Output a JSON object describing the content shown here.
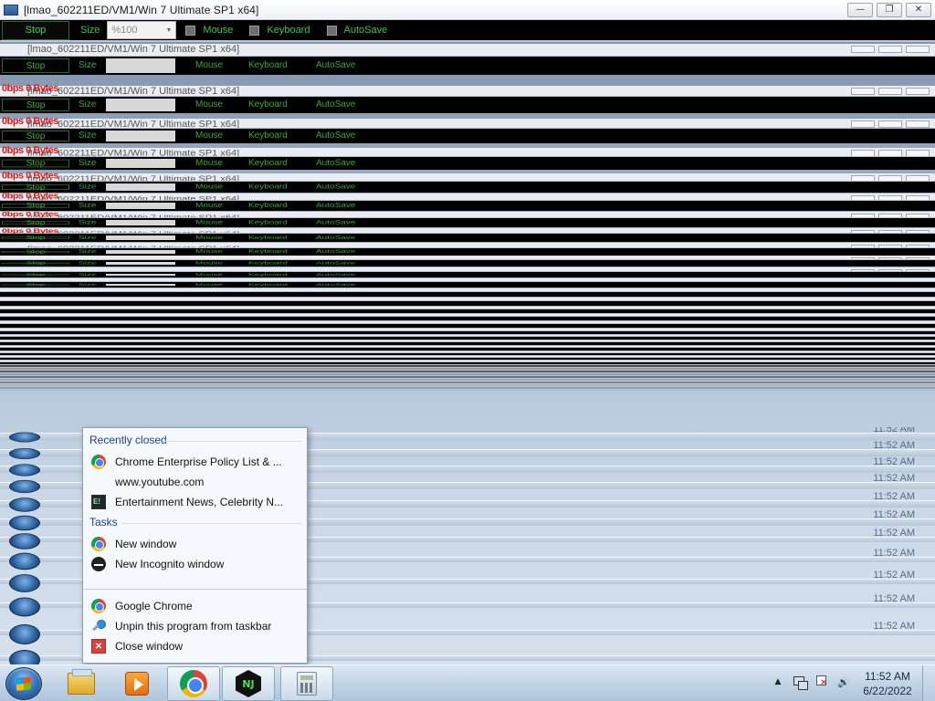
{
  "viewer": {
    "title": "[lmao_602211ED/VM1/Win 7 Ultimate SP1 x64]",
    "window_buttons": {
      "minimize": "—",
      "restore": "❐",
      "close": "✕"
    },
    "toolbar": {
      "stop_label": "Stop",
      "size_label": "Size",
      "size_value": "%100",
      "mouse_label": "Mouse",
      "keyboard_label": "Keyboard",
      "autosave_label": "AutoSave"
    }
  },
  "glitch_overlay_text": "0bps 0 Bytes",
  "jump_list": {
    "recently_closed_header": "Recently closed",
    "recent_items": [
      {
        "label": "Chrome Enterprise Policy List & ...",
        "icon": "chrome-icon"
      },
      {
        "label": "www.youtube.com",
        "icon": ""
      },
      {
        "label": "Entertainment News, Celebrity N...",
        "icon": "entertainment-site-icon"
      }
    ],
    "tasks_header": "Tasks",
    "tasks": [
      {
        "label": "New window",
        "icon": "chrome-icon"
      },
      {
        "label": "New Incognito window",
        "icon": "incognito-icon"
      }
    ],
    "app_items": [
      {
        "label": "Google Chrome",
        "icon": "chrome-icon"
      },
      {
        "label": "Unpin this program from taskbar",
        "icon": "unpin-icon"
      },
      {
        "label": "Close window",
        "icon": "close-window-icon"
      }
    ]
  },
  "taskbar": {
    "apps": [
      {
        "name": "Windows Explorer",
        "icon": "explorer-icon"
      },
      {
        "name": "Windows Media Player",
        "icon": "media-player-icon"
      },
      {
        "name": "Google Chrome",
        "icon": "chrome-icon",
        "active": true
      },
      {
        "name": "NJ app",
        "icon": "nj-icon",
        "active": true
      },
      {
        "name": "Calculator",
        "icon": "calculator-icon"
      }
    ],
    "nj_icon_text": "NJ",
    "tray": {
      "expand": "▲",
      "volume": "🔊"
    },
    "clock": {
      "time": "11:52 AM",
      "date": "6/22/2022"
    }
  },
  "colors": {
    "toolbar_bg": "#000000",
    "toolbar_text": "#41c441",
    "jump_header": "#1e3f8f",
    "overlay_red": "#e01818"
  }
}
